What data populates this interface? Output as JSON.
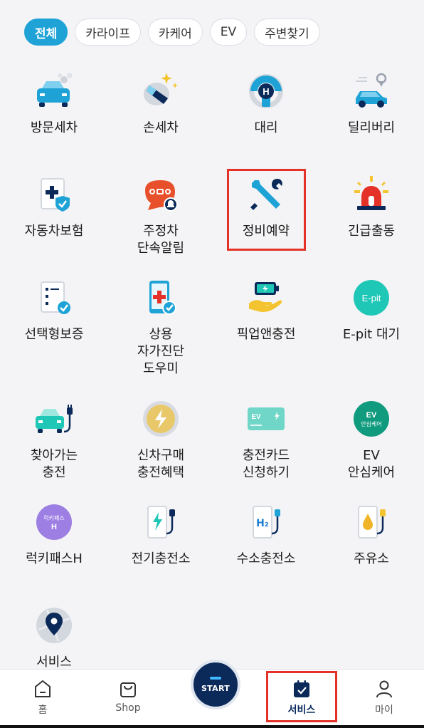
{
  "filters": [
    "전체",
    "카라이프",
    "카케어",
    "EV",
    "주변찾기"
  ],
  "services": [
    {
      "label": "방문세차",
      "icon": "mobile-wash-car-icon"
    },
    {
      "label": "손세차",
      "icon": "hand-wash-icon"
    },
    {
      "label": "대리",
      "icon": "steering-wheel-icon"
    },
    {
      "label": "딜리버리",
      "icon": "car-delivery-icon"
    },
    {
      "label": "자동차보험",
      "icon": "insurance-document-icon"
    },
    {
      "label": "주정차\n단속알림",
      "icon": "parking-alert-icon"
    },
    {
      "label": "정비예약",
      "icon": "wrench-screwdriver-icon"
    },
    {
      "label": "긴급출동",
      "icon": "emergency-siren-icon"
    },
    {
      "label": "선택형보증",
      "icon": "warranty-checklist-icon"
    },
    {
      "label": "상용\n자가진단\n도우미",
      "icon": "phone-diagnosis-icon"
    },
    {
      "label": "픽업앤충전",
      "icon": "battery-hand-icon"
    },
    {
      "label": "E-pit 대기",
      "icon": "epit-icon"
    },
    {
      "label": "찾아가는\n충전",
      "icon": "mobile-charging-car-icon"
    },
    {
      "label": "신차구매\n충전혜택",
      "icon": "lightning-coin-icon"
    },
    {
      "label": "충전카드\n신청하기",
      "icon": "ev-charge-card-icon"
    },
    {
      "label": "EV\n안심케어",
      "icon": "ev-care-icon"
    },
    {
      "label": "럭키패스H",
      "icon": "lucky-pass-icon"
    },
    {
      "label": "전기충전소",
      "icon": "ev-charging-station-icon"
    },
    {
      "label": "수소충전소",
      "icon": "hydrogen-station-icon"
    },
    {
      "label": "주유소",
      "icon": "gas-station-icon"
    },
    {
      "label": "서비스",
      "icon": "map-pin-icon"
    }
  ],
  "icon_text": {
    "steering": "H",
    "epit": "E-pit",
    "ev_card": "EV",
    "ev_care_top": "EV",
    "ev_care_bottom": "안심케어",
    "lucky_top": "럭키패스",
    "lucky_bottom": "H",
    "h2": "H₂"
  },
  "tabbar": {
    "home": "홈",
    "shop": "Shop",
    "start": "START",
    "service": "서비스",
    "my": "마이"
  },
  "colors": {
    "accent": "#1fa3d6",
    "navy": "#0b2a59",
    "highlight": "#e53228"
  }
}
